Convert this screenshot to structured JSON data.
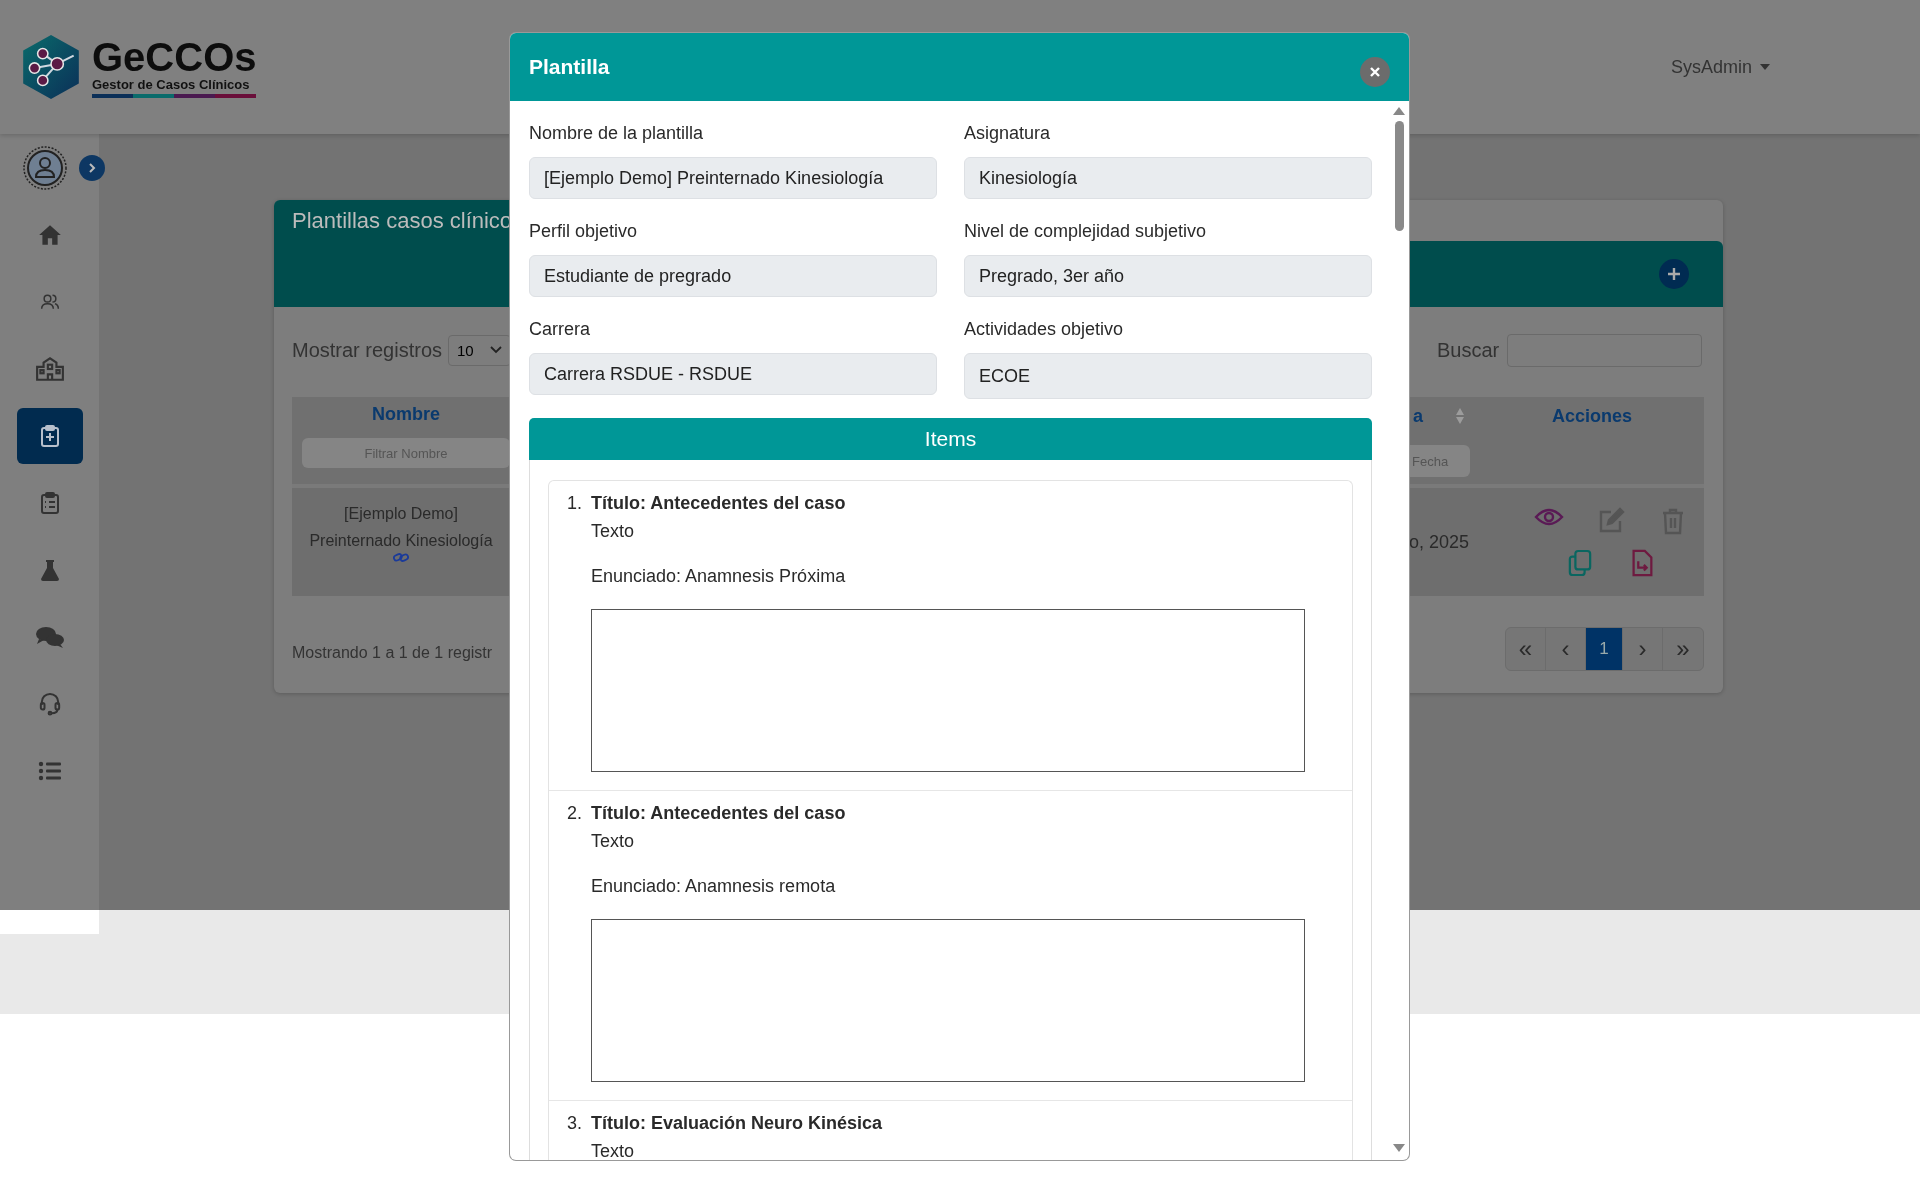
{
  "header": {
    "logo_title": "GeCCOs",
    "logo_subtitle": "Gestor de Casos Clínicos",
    "user_menu": "SysAdmin"
  },
  "sidebar": {
    "items": [
      {
        "kind": "home",
        "selected": false
      },
      {
        "kind": "users",
        "selected": false
      },
      {
        "kind": "building",
        "selected": false
      },
      {
        "kind": "clipboard-plus",
        "selected": true
      },
      {
        "kind": "clipboard-list",
        "selected": false
      },
      {
        "kind": "flask",
        "selected": false
      },
      {
        "kind": "chat",
        "selected": false
      },
      {
        "kind": "headset",
        "selected": false
      },
      {
        "kind": "list",
        "selected": false
      }
    ]
  },
  "page": {
    "title": "Plantillas casos clínico",
    "show_label": "Mostrar registros",
    "page_size": "10",
    "search_label": "Buscar",
    "columns": [
      {
        "label": "Nombre",
        "filter_placeholder": "Filtrar Nombre"
      },
      {
        "label": "a",
        "filter_placeholder": "Fecha"
      },
      {
        "label": "Acciones"
      }
    ],
    "rows": [
      {
        "name_lines": [
          "[Ejemplo Demo]",
          "Preinternado Kinesiología"
        ],
        "date": "o, 2025",
        "actions": [
          {
            "kind": "view"
          },
          {
            "kind": "edit"
          },
          {
            "kind": "delete"
          },
          {
            "kind": "copy"
          },
          {
            "kind": "export"
          }
        ]
      }
    ],
    "footer": "Mostrando 1 a 1 de 1 registr",
    "pagination": [
      {
        "label": "«",
        "selected": false
      },
      {
        "label": "‹",
        "selected": false
      },
      {
        "label": "1",
        "selected": true
      },
      {
        "label": "›",
        "selected": false
      },
      {
        "label": "»",
        "selected": false
      }
    ]
  },
  "modal": {
    "title": "Plantilla",
    "fields": [
      {
        "label": "Nombre de la plantilla",
        "value": "[Ejemplo Demo] Preinternado Kinesiología"
      },
      {
        "label": "Asignatura",
        "value": "Kinesiología"
      },
      {
        "label": "Perfil objetivo",
        "value": "Estudiante de pregrado"
      },
      {
        "label": "Nivel de complejidad subjetivo",
        "value": "Pregrado, 3er año"
      },
      {
        "label": "Carrera",
        "value": "Carrera RSDUE - RSDUE"
      },
      {
        "label": "Actividades objetivo",
        "value": "ECOE"
      }
    ],
    "items_title": "Items",
    "items": [
      {
        "number": "1.",
        "title": "Título: Antecedentes del caso",
        "type": "Texto",
        "statement": "Enunciado: Anamnesis Próxima",
        "answer_box": true
      },
      {
        "number": "2.",
        "title": "Título: Antecedentes del caso",
        "type": "Texto",
        "statement": "Enunciado: Anamnesis remota",
        "answer_box": true
      },
      {
        "number": "3.",
        "title": "Título: Evaluación Neuro Kinésica",
        "type": "Texto",
        "answer_box": false
      }
    ]
  }
}
